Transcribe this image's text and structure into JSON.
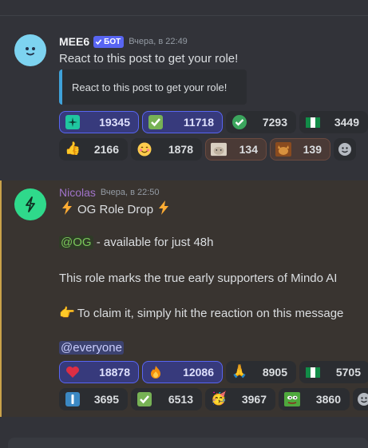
{
  "message1": {
    "author": "MEE6",
    "bot_badge": "БОТ",
    "timestamp": "Вчера, в 22:49",
    "text": "React to this post to get your role!",
    "embed_text": "React to this post to get your role!",
    "reactions": [
      {
        "emoji": "sparkle-green-icon",
        "count": "19345"
      },
      {
        "emoji": "check-box-green-icon",
        "count": "11718"
      },
      {
        "emoji": "check-circle-green-icon",
        "count": "7293"
      },
      {
        "emoji": "nigeria-flag-icon",
        "count": "3449"
      },
      {
        "emoji": "thumbs-up-icon",
        "count": "2166"
      },
      {
        "emoji": "smiling-face-icon",
        "count": "1878"
      },
      {
        "emoji": "cat-meme-icon",
        "count": "134"
      },
      {
        "emoji": "doge-icon",
        "count": "139"
      }
    ]
  },
  "message2": {
    "author": "Nicolas",
    "timestamp": "Вчера, в 22:50",
    "title": "OG Role Drop",
    "og_mention": "@OG",
    "availability": " - available for just 48h",
    "body": "This role marks the true early supporters of Mindo AI",
    "claim": "To claim it, simply hit the reaction on this message",
    "everyone_mention": "@everyone",
    "reactions": [
      {
        "emoji": "red-heart-icon",
        "count": "18878"
      },
      {
        "emoji": "fire-icon",
        "count": "12086"
      },
      {
        "emoji": "folded-hands-icon",
        "count": "8905"
      },
      {
        "emoji": "nigeria-flag-icon",
        "count": "5705"
      },
      {
        "emoji": "exclamation-box-icon",
        "count": "3695"
      },
      {
        "emoji": "check-box-green-icon",
        "count": "6513"
      },
      {
        "emoji": "partying-face-icon",
        "count": "3967"
      },
      {
        "emoji": "pepe-icon",
        "count": "3860"
      }
    ]
  },
  "colors": {
    "accent": "#5865f2",
    "background": "#323339",
    "highlight_border": "#c9a24a"
  }
}
